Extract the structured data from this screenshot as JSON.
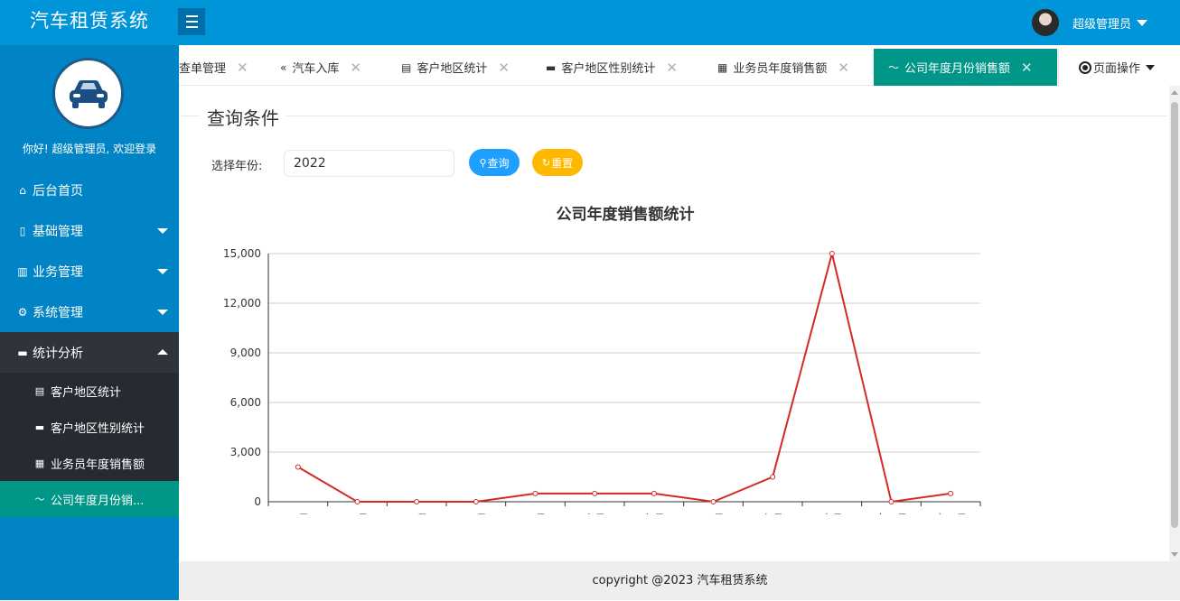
{
  "app": {
    "title": "汽车租赁系统"
  },
  "header": {
    "user_name": "超级管理员"
  },
  "sidebar": {
    "welcome": "你好!  超级管理员, 欢迎登录",
    "items": [
      {
        "label": "后台首页",
        "icon": "home-icon"
      },
      {
        "label": "基础管理",
        "icon": "file-icon"
      },
      {
        "label": "业务管理",
        "icon": "business-icon"
      },
      {
        "label": "系统管理",
        "icon": "gear-icon"
      },
      {
        "label": "统计分析",
        "icon": "chart-icon"
      }
    ],
    "sub_items": [
      {
        "label": "客户地区统计",
        "icon": "clipboard-icon"
      },
      {
        "label": "客户地区性别统计",
        "icon": "monitor-icon"
      },
      {
        "label": "业务员年度销售额",
        "icon": "table-icon"
      },
      {
        "label": "公司年度月份销...",
        "icon": "pulse-icon"
      }
    ]
  },
  "tabs": [
    {
      "label": "查单管理",
      "icon": ""
    },
    {
      "label": "汽车入库",
      "icon": "double-left-icon"
    },
    {
      "label": "客户地区统计",
      "icon": "clipboard-icon"
    },
    {
      "label": "客户地区性别统计",
      "icon": "monitor-icon"
    },
    {
      "label": "业务员年度销售额",
      "icon": "table-icon"
    },
    {
      "label": "公司年度月份销售额",
      "icon": "pulse-icon"
    }
  ],
  "page_op_label": "页面操作",
  "form": {
    "legend": "查询条件",
    "year_label": "选择年份:",
    "year_value": "2022",
    "search_label": "查询",
    "reset_label": "重置"
  },
  "chart_data": {
    "type": "line",
    "title": "公司年度销售额统计",
    "categories": [
      "一月",
      "二月",
      "三月",
      "四月",
      "五月",
      "六月",
      "七月",
      "八月",
      "九月",
      "十月",
      "十一月",
      "十二月"
    ],
    "values": [
      2100,
      0,
      0,
      0,
      500,
      500,
      500,
      0,
      1500,
      15000,
      0,
      500
    ],
    "ylim": [
      0,
      15000
    ],
    "yticks": [
      "0",
      "3,000",
      "6,000",
      "9,000",
      "12,000",
      "15,000"
    ],
    "grid": true,
    "color": "#d42a26"
  },
  "footer": {
    "text": "copyright @2023 汽车租赁系统"
  }
}
